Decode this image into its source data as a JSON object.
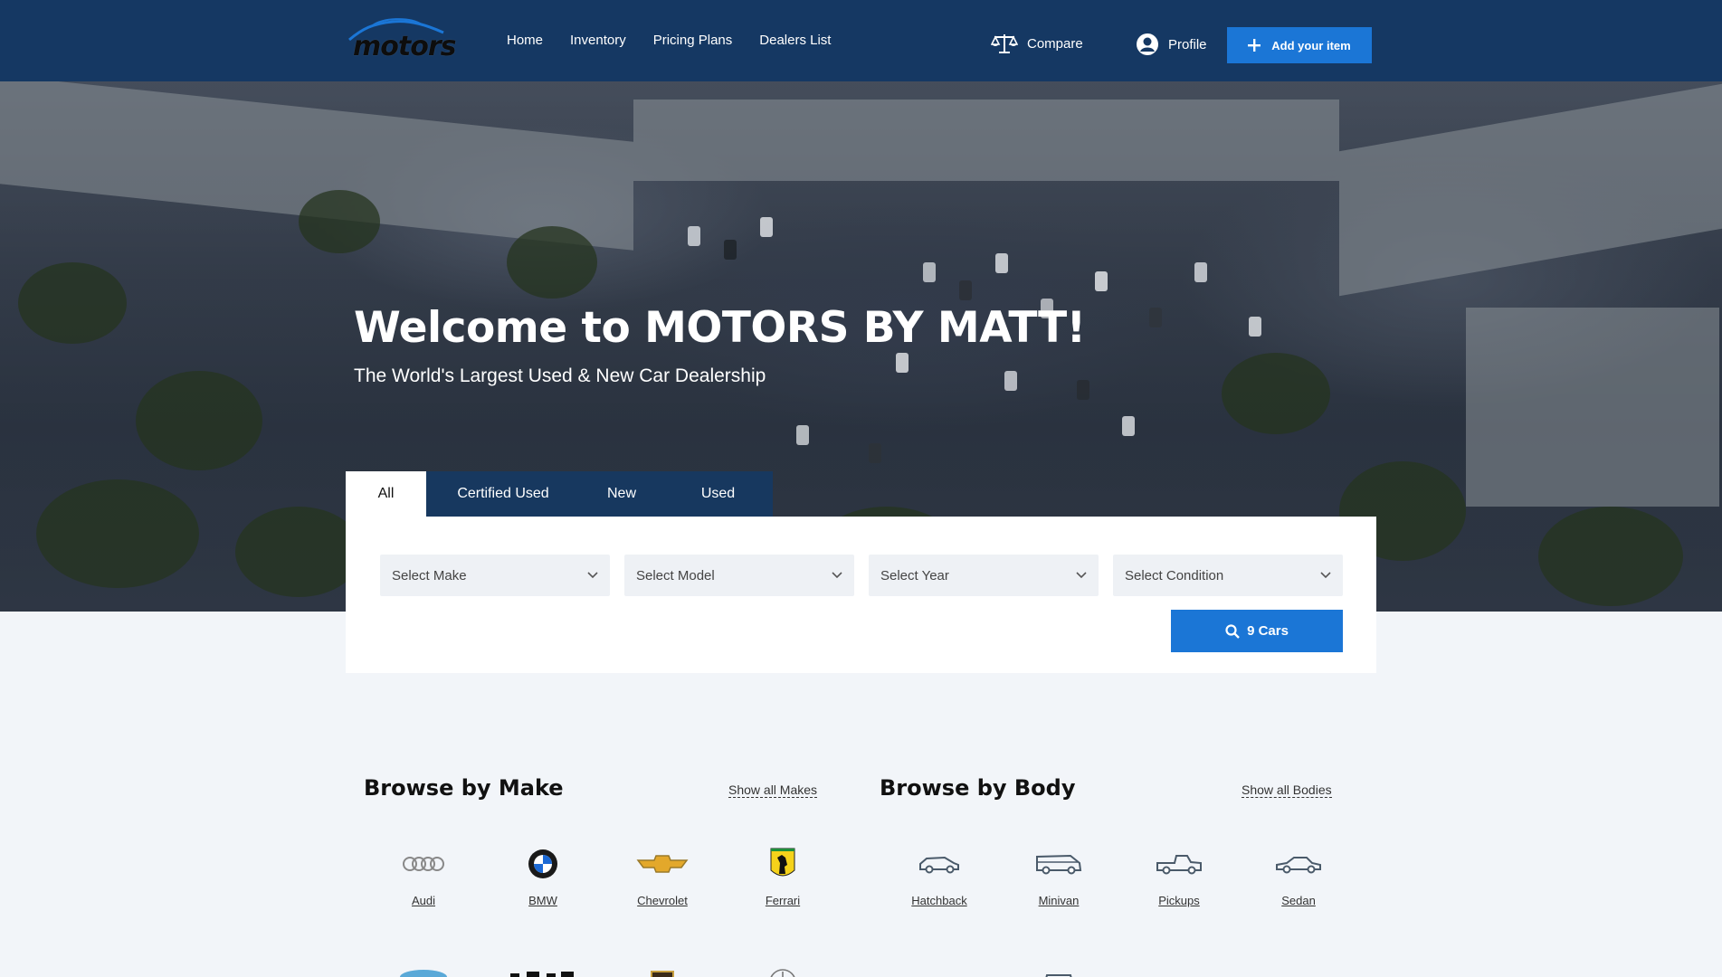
{
  "brand": {
    "logo_text": "motors",
    "accent": "#1b76d6",
    "header_bg": "#153863"
  },
  "nav": {
    "items": [
      "Home",
      "Inventory",
      "Pricing Plans",
      "Dealers List"
    ]
  },
  "header_actions": {
    "compare": "Compare",
    "profile": "Profile",
    "add_item": "Add your item"
  },
  "hero": {
    "title": "Welcome to MOTORS BY MATT!",
    "subtitle": "The World's Largest Used & New Car Dealership"
  },
  "search": {
    "tabs": [
      "All",
      "Certified Used",
      "New",
      "Used"
    ],
    "active_tab": "All",
    "selects": [
      "Select Make",
      "Select Model",
      "Select Year",
      "Select Condition"
    ],
    "button": "9 Cars"
  },
  "browse_make": {
    "title": "Browse by Make",
    "show_all": "Show all Makes",
    "items": [
      "Audi",
      "BMW",
      "Chevrolet",
      "Ferrari"
    ]
  },
  "browse_body": {
    "title": "Browse by Body",
    "show_all": "Show all Bodies",
    "items": [
      "Hatchback",
      "Minivan",
      "Pickups",
      "Sedan"
    ]
  },
  "icons": {
    "compare": "scale-icon",
    "profile": "user-circle-icon",
    "add": "plus-icon",
    "search": "search-icon",
    "select": "chevron-down-icon"
  }
}
